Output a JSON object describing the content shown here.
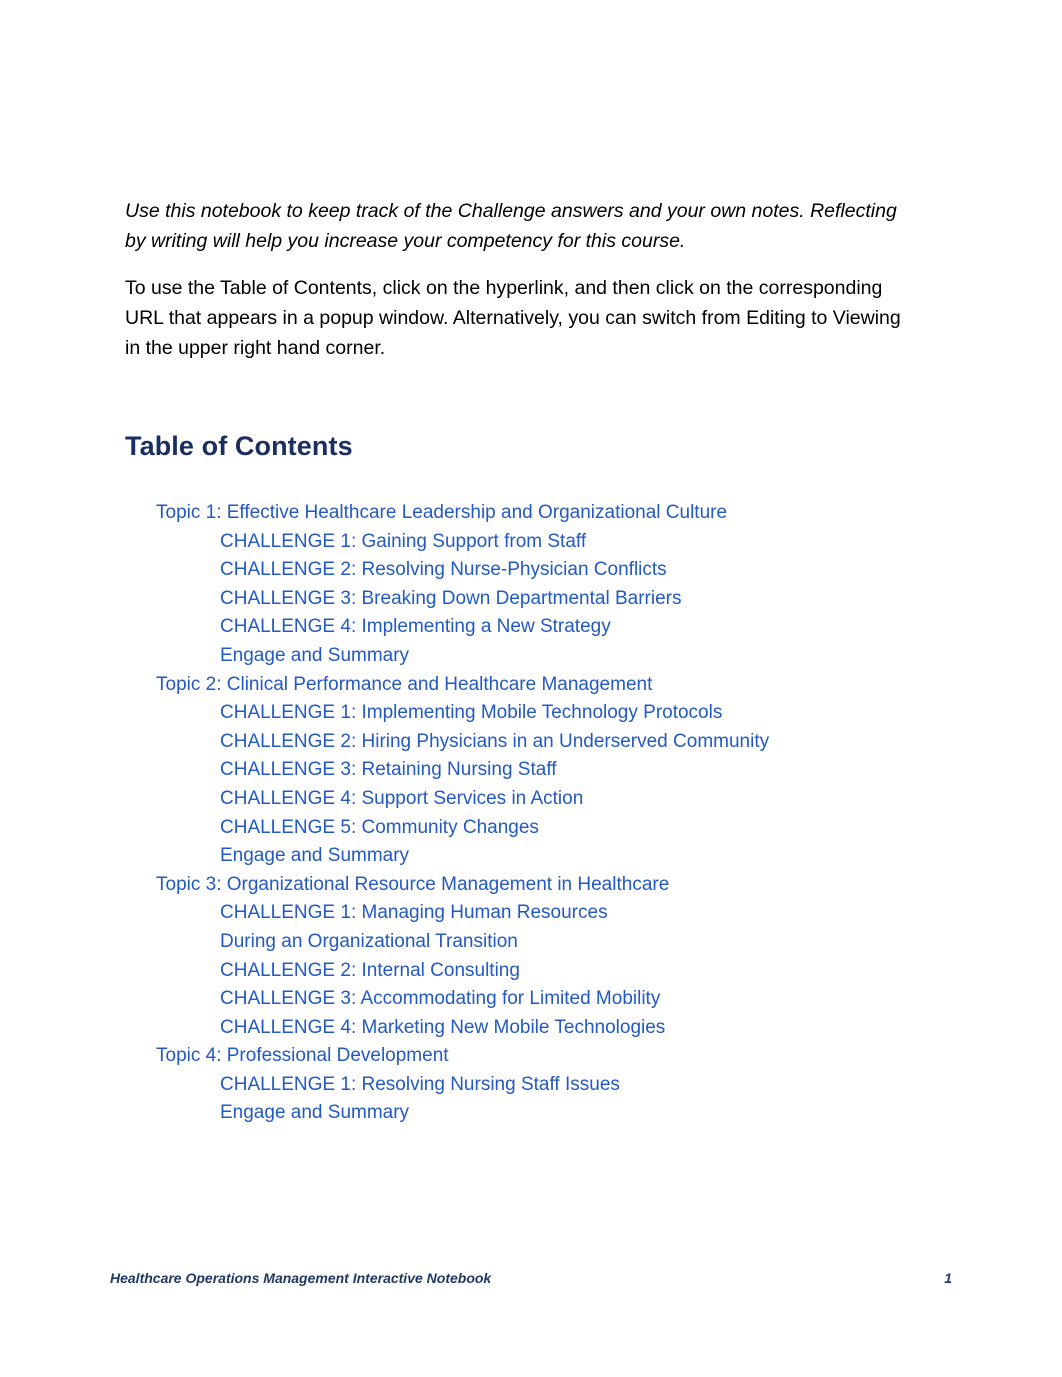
{
  "document": {
    "intro_italic": "Use this notebook to keep track of the Challenge answers and your own notes. Reflecting by writing will help you increase your competency for this course.",
    "intro_plain": "To use the Table of Contents, click on the hyperlink, and then click on the corresponding URL that appears in a popup window. Alternatively, you can switch from Editing to Viewing in the upper right hand corner.",
    "toc_heading": "Table of Contents"
  },
  "colors": {
    "heading": "#1a2e62",
    "link": "#2259c4",
    "footer": "#1f3864",
    "body_text": "#000000",
    "page_background": "#ffffff"
  },
  "toc": {
    "entries": [
      {
        "level": "topic",
        "label": "Topic 1: Effective Healthcare Leadership and Organizational Culture"
      },
      {
        "level": "child",
        "label": "CHALLENGE 1: Gaining Support from Staff"
      },
      {
        "level": "child",
        "label": "CHALLENGE 2: Resolving Nurse-Physician Conflicts"
      },
      {
        "level": "child",
        "label": "CHALLENGE 3: Breaking Down Departmental Barriers"
      },
      {
        "level": "child",
        "label": "CHALLENGE 4: Implementing a New Strategy"
      },
      {
        "level": "child",
        "label": "Engage and Summary"
      },
      {
        "level": "topic",
        "label": "Topic 2: Clinical Performance and Healthcare Management"
      },
      {
        "level": "child",
        "label": "CHALLENGE 1: Implementing Mobile Technology Protocols"
      },
      {
        "level": "child",
        "label": "CHALLENGE 2: Hiring Physicians in an Underserved Community"
      },
      {
        "level": "child",
        "label": "CHALLENGE 3: Retaining Nursing Staff"
      },
      {
        "level": "child",
        "label": "CHALLENGE 4: Support Services in Action"
      },
      {
        "level": "child",
        "label": "CHALLENGE 5: Community Changes"
      },
      {
        "level": "child",
        "label": "Engage and Summary"
      },
      {
        "level": "topic",
        "label": "Topic 3: Organizational Resource Management in Healthcare"
      },
      {
        "level": "child",
        "label": "CHALLENGE 1: Managing Human Resources"
      },
      {
        "level": "child",
        "label": "During an Organizational Transition"
      },
      {
        "level": "child",
        "label": "CHALLENGE 2: Internal Consulting"
      },
      {
        "level": "child",
        "label": "CHALLENGE 3: Accommodating for Limited Mobility"
      },
      {
        "level": "child",
        "label": "CHALLENGE 4: Marketing New Mobile Technologies"
      },
      {
        "level": "topic",
        "label": "Topic 4: Professional Development"
      },
      {
        "level": "child",
        "label": "CHALLENGE 1: Resolving Nursing Staff Issues"
      },
      {
        "level": "child",
        "label": "Engage and Summary"
      }
    ]
  },
  "footer": {
    "title": "Healthcare Operations Management Interactive Notebook",
    "page_number": "1"
  }
}
